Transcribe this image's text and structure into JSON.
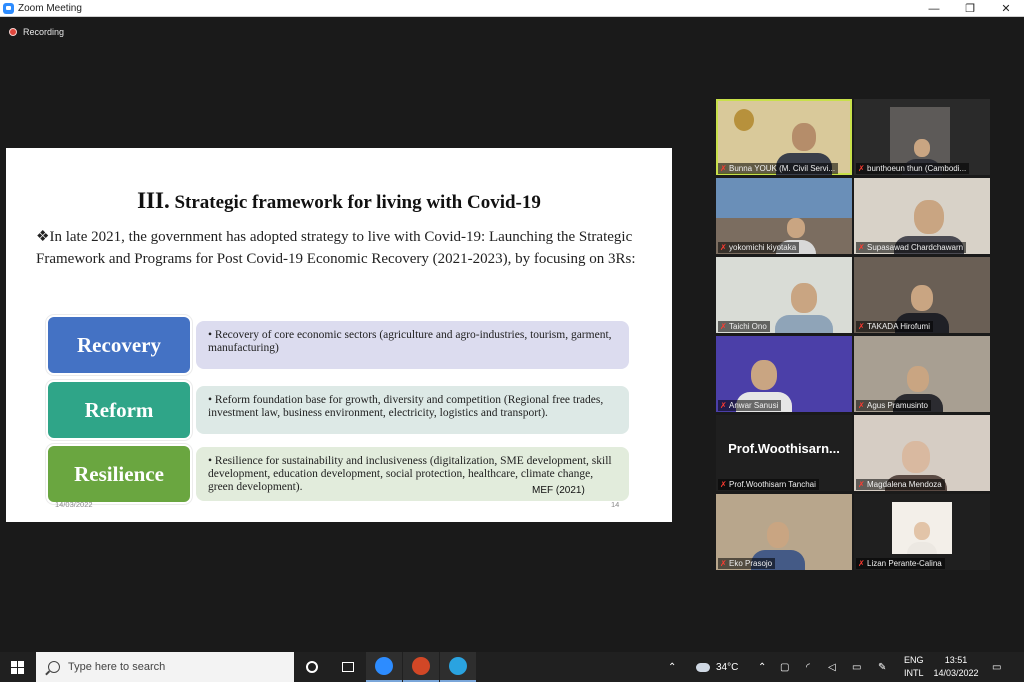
{
  "window": {
    "title": "Zoom Meeting",
    "minimize_glyph": "—",
    "restore_glyph": "❐",
    "close_glyph": "✕"
  },
  "recording": {
    "label": "Recording"
  },
  "slide": {
    "title_roman": "III.",
    "title": "Strategic framework for living with Covid-19",
    "bullet_symbol": "❖",
    "bullet_text": "In late 2021, the government has adopted strategy to live with Covid-19: Launching the Strategic Framework and Programs for Post Covid-19 Economic Recovery (2021-2023), by focusing on 3Rs:",
    "rows": [
      {
        "label": "Recovery",
        "desc": "• Recovery of core economic sectors (agriculture and agro-industries, tourism, garment, manufacturing)",
        "label_color": "#4472c4",
        "desc_color": "#dcdcef"
      },
      {
        "label": "Reform",
        "desc": "• Reform foundation base for growth, diversity and competition (Regional free trades, investment law, business environment, electricity, logistics and transport).",
        "label_color": "#2fa588",
        "desc_color": "#dde9e6"
      },
      {
        "label": "Resilience",
        "desc": "• Resilience for sustainability and inclusiveness (digitalization, SME development, skill development, education development, social protection, healthcare, climate change, green development).",
        "label_color": "#6aa640",
        "desc_color": "#e2ecdc"
      }
    ],
    "date": "14/03/2022",
    "source": "MEF (2021)",
    "page": "14"
  },
  "participants": [
    {
      "name": "Bunna YOUK (M. Civil Servi...",
      "bg": "#d9c99a",
      "active": true
    },
    {
      "name": "bunthoeun thun (Cambodi...",
      "bg": "#2a2a2a"
    },
    {
      "name": "yokomichi kiyotaka",
      "bg": "#6a8fb8"
    },
    {
      "name": "Supasawad Chardchawarn",
      "bg": "#d8d2c8"
    },
    {
      "name": "Taichi Ono",
      "bg": "#d9dcd6"
    },
    {
      "name": "TAKADA Hirofumi",
      "bg": "#6a5f55"
    },
    {
      "name": "Anwar Sanusi",
      "bg": "#4b3fa8"
    },
    {
      "name": "Agus Pramusinto",
      "bg": "#a89f92"
    },
    {
      "name": "Prof.Woothisarn Tanchai",
      "bg": "#1f1f1f",
      "big_label": "Prof.Woothisarn..."
    },
    {
      "name": "Magdalena Mendoza",
      "bg": "#d6cdc4"
    },
    {
      "name": "Eko Prasojo",
      "bg": "#b8a68c"
    },
    {
      "name": "Lizan Perante-Calina",
      "bg": "#f3efe9"
    }
  ],
  "taskbar": {
    "search_placeholder": "Type here to search",
    "temperature": "34°C",
    "lang_1": "ENG",
    "lang_2": "INTL",
    "time": "13:51",
    "date": "14/03/2022"
  }
}
